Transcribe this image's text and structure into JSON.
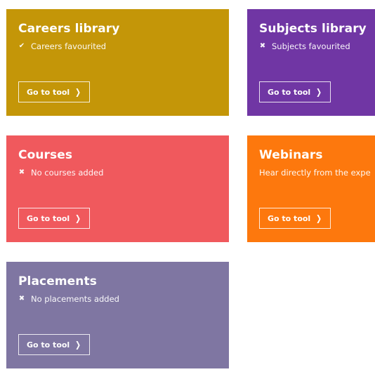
{
  "cards": [
    {
      "id": "careers",
      "title": "Careers library",
      "status_icon": "check-icon",
      "status_glyph": "✔",
      "status_text": "Careers favourited",
      "button_label": "Go to tool",
      "color": "#c49608"
    },
    {
      "id": "subjects",
      "title": "Subjects library",
      "status_icon": "cross-icon",
      "status_glyph": "✖",
      "status_text": "Subjects favourited",
      "button_label": "Go to tool",
      "color": "#7036a4"
    },
    {
      "id": "courses",
      "title": "Courses",
      "status_icon": "cross-icon",
      "status_glyph": "✖",
      "status_text": "No courses added",
      "button_label": "Go to tool",
      "color": "#f0595d"
    },
    {
      "id": "webinars",
      "title": "Webinars",
      "status_text": "Hear directly from the expe",
      "button_label": "Go to tool",
      "color": "#fd780d"
    },
    {
      "id": "placements",
      "title": "Placements",
      "status_icon": "cross-icon",
      "status_glyph": "✖",
      "status_text": "No placements added",
      "button_label": "Go to tool",
      "color": "#7f76a2"
    }
  ],
  "chevron_glyph": "❯"
}
